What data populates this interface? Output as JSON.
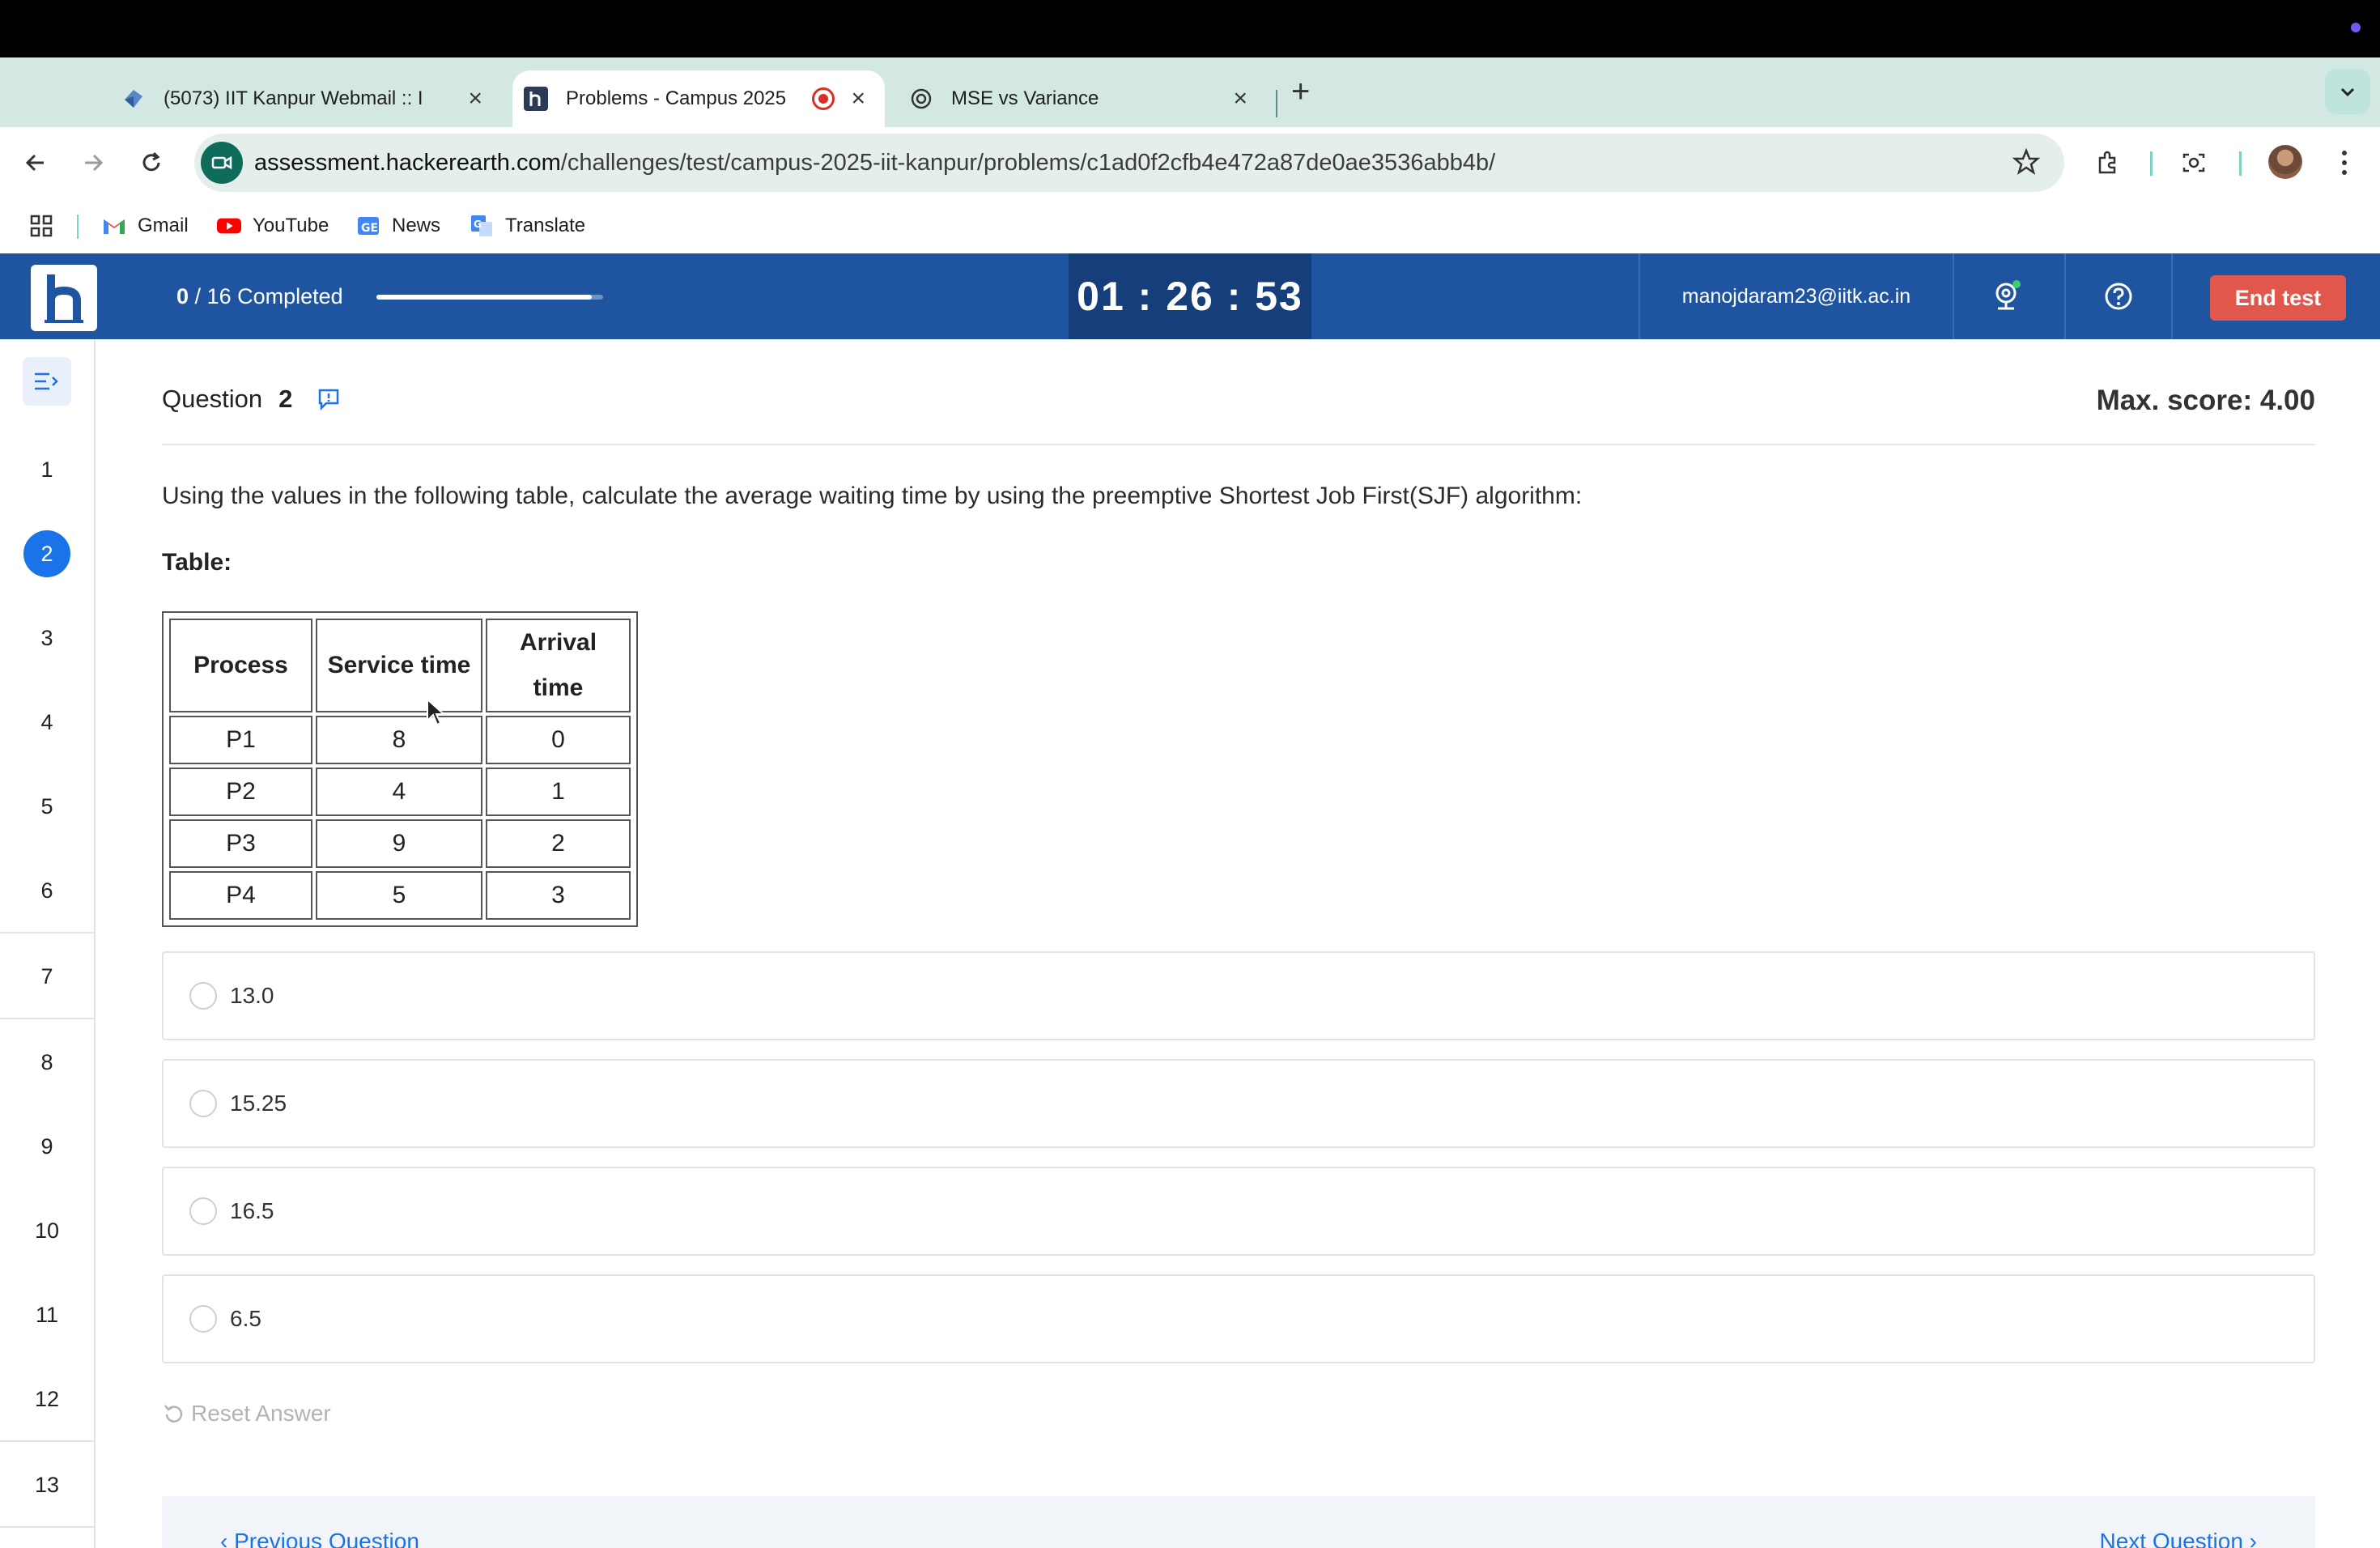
{
  "browser": {
    "tabs": [
      {
        "title": "(5073) IIT Kanpur Webmail :: I",
        "favicon": "webmail-icon"
      },
      {
        "title": "Problems - Campus 2025",
        "favicon": "hackerearth-icon",
        "recording": true,
        "active": true
      },
      {
        "title": "MSE vs Variance",
        "favicon": "chatgpt-icon"
      }
    ],
    "url_host": "assessment.hackerearth.com",
    "url_path": "/challenges/test/campus-2025-iit-kanpur/problems/c1ad0f2cfb4e472a87de0ae3536abb4b/",
    "bookmarks": [
      {
        "label": "Gmail",
        "icon": "gmail-icon"
      },
      {
        "label": "YouTube",
        "icon": "youtube-icon"
      },
      {
        "label": "News",
        "icon": "news-icon"
      },
      {
        "label": "Translate",
        "icon": "translate-icon"
      }
    ]
  },
  "header": {
    "completed": "0",
    "total": "/ 16",
    "completed_label": "Completed",
    "progress_fraction": 0.95,
    "timer": "01 : 26 : 53",
    "email": "manojdaram23@iitk.ac.in",
    "end_test": "End test",
    "colors": {
      "header": "#1f55a0",
      "timer_bg": "#153e7a",
      "end_test": "#e2574c"
    }
  },
  "sidebar": {
    "questions": [
      "1",
      "2",
      "3",
      "4",
      "5",
      "6",
      "7",
      "8",
      "9",
      "10",
      "11",
      "12",
      "13"
    ],
    "current": "2"
  },
  "question": {
    "label": "Question",
    "number": "2",
    "max_score": "Max. score: 4.00",
    "text": "Using the values in the following table, calculate the average waiting time by using the preemptive Shortest Job First(SJF) algorithm:",
    "table_label": "Table:",
    "table": {
      "headers": [
        "Process",
        "Service time",
        "Arrival time"
      ],
      "rows": [
        [
          "P1",
          "8",
          "0"
        ],
        [
          "P2",
          "4",
          "1"
        ],
        [
          "P3",
          "9",
          "2"
        ],
        [
          "P4",
          "5",
          "3"
        ]
      ]
    },
    "options": [
      "13.0",
      "15.25",
      "16.5",
      "6.5"
    ],
    "reset_label": "Reset Answer"
  },
  "footer": {
    "previous": "‹ Previous Question",
    "next": "Next Question ›"
  }
}
